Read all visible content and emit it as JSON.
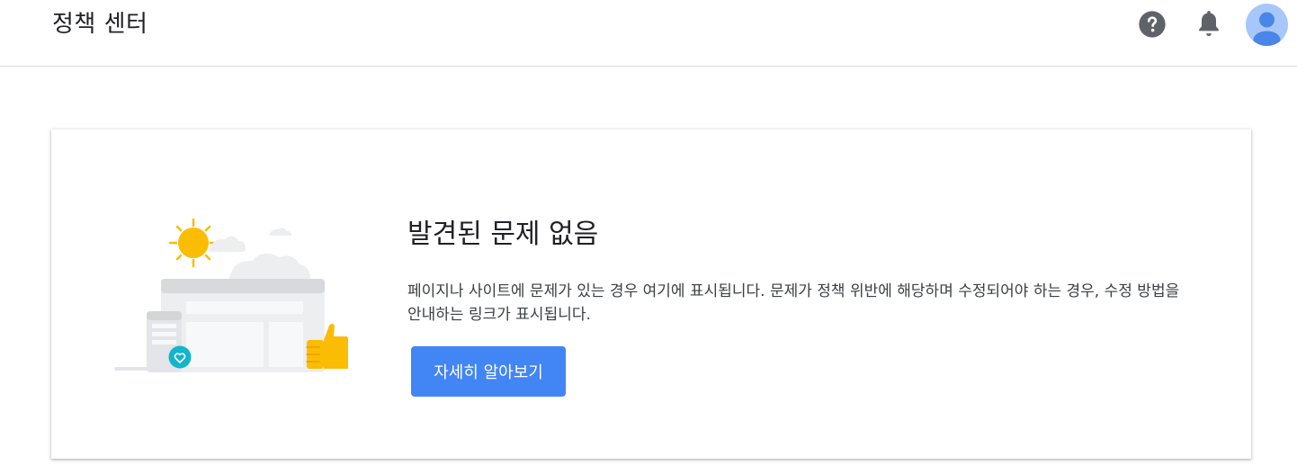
{
  "header": {
    "title": "정책 센터",
    "help_icon": "help-circle-icon",
    "notifications_icon": "bell-icon",
    "avatar_icon": "account-avatar-icon"
  },
  "status_card": {
    "title": "발견된 문제 없음",
    "description": "페이지나 사이트에 문제가 있는 경우 여기에 표시됩니다. 문제가 정책 위반에 해당하며 수정되어야 하는 경우, 수정 방법을 안내하는 링크가 표시됩니다.",
    "button_label": "자세히 알아보기",
    "illustration": "sunny-website-thumbs-up-illustration"
  },
  "colors": {
    "accent": "#4285f4",
    "sun": "#fbbc04",
    "badge": "#12b5cb",
    "avatar_bg": "#a7c7fa",
    "avatar_fg": "#4a86e8",
    "icon_gray": "#5f6368"
  }
}
